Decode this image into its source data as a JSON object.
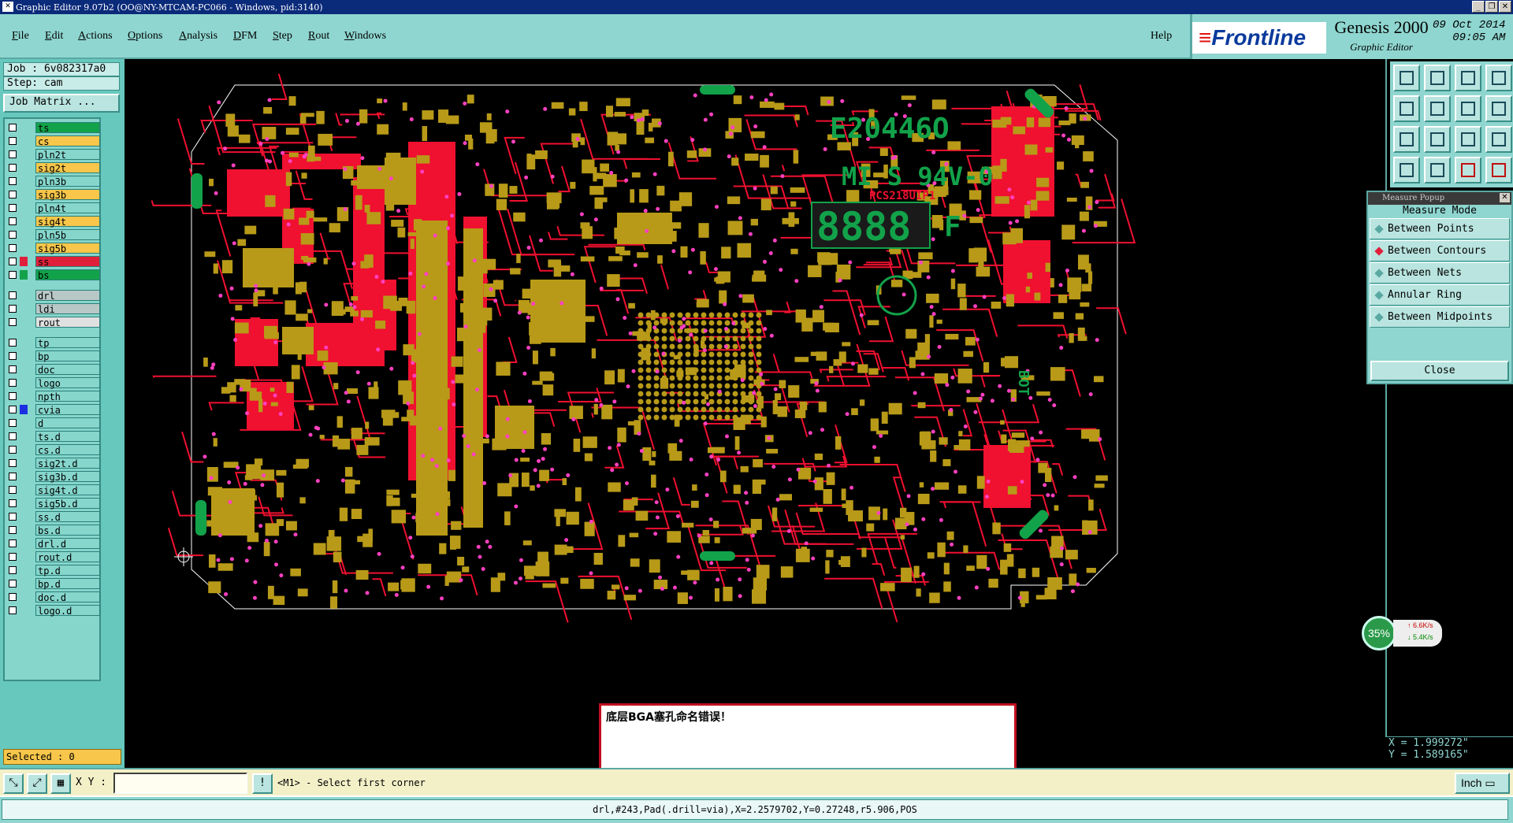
{
  "window": {
    "title": "Graphic Editor 9.07b2 (OO@NY-MTCAM-PC066 - Windows, pid:3140)",
    "controls": [
      "_",
      "❐",
      "✕"
    ]
  },
  "menu": [
    "File",
    "Edit",
    "Actions",
    "Options",
    "Analysis",
    "DFM",
    "Step",
    "Rout",
    "Windows"
  ],
  "help": "Help",
  "brand": {
    "logo": "Frontline",
    "product": "Genesis 2000",
    "subtitle": "Graphic Editor",
    "date": "09 Oct 2014",
    "time": "09:05 AM"
  },
  "left": {
    "job": "Job : 6v082317a0",
    "step": "Step: cam",
    "job_matrix": "Job Matrix ...",
    "selected": "Selected : 0",
    "layers": [
      {
        "name": "ts",
        "color": "#12a24a",
        "swatch": ""
      },
      {
        "name": "cs",
        "color": "#f7c64a",
        "swatch": ""
      },
      {
        "name": "pln2t",
        "color": "#86d6cc",
        "swatch": ""
      },
      {
        "name": "sig2t",
        "color": "#f7c64a",
        "swatch": ""
      },
      {
        "name": "pln3b",
        "color": "#86d6cc",
        "swatch": ""
      },
      {
        "name": "sig3b",
        "color": "#f7c64a",
        "swatch": ""
      },
      {
        "name": "pln4t",
        "color": "#86d6cc",
        "swatch": ""
      },
      {
        "name": "sig4t",
        "color": "#f7c64a",
        "swatch": ""
      },
      {
        "name": "pln5b",
        "color": "#86d6cc",
        "swatch": ""
      },
      {
        "name": "sig5b",
        "color": "#f7c64a",
        "swatch": ""
      },
      {
        "name": "ss",
        "color": "#e0203a",
        "swatch": "#e0203a"
      },
      {
        "name": "bs",
        "color": "#12a24a",
        "swatch": "#12a24a"
      },
      {
        "name": "drl",
        "color": "#b8c8c6",
        "swatch": ""
      },
      {
        "name": "ldi",
        "color": "#b8c8c6",
        "swatch": ""
      },
      {
        "name": "rout",
        "color": "#e0e0e0",
        "swatch": ""
      },
      {
        "name": "tp",
        "color": "#86d6cc",
        "swatch": ""
      },
      {
        "name": "bp",
        "color": "#86d6cc",
        "swatch": ""
      },
      {
        "name": "doc",
        "color": "#86d6cc",
        "swatch": ""
      },
      {
        "name": "logo",
        "color": "#86d6cc",
        "swatch": ""
      },
      {
        "name": "npth",
        "color": "#86d6cc",
        "swatch": ""
      },
      {
        "name": "cvia",
        "color": "#86d6cc",
        "swatch": "#1a30e0"
      },
      {
        "name": "d",
        "color": "#86d6cc",
        "swatch": ""
      },
      {
        "name": "ts.d",
        "color": "#86d6cc",
        "swatch": ""
      },
      {
        "name": "cs.d",
        "color": "#86d6cc",
        "swatch": ""
      },
      {
        "name": "sig2t.d",
        "color": "#86d6cc",
        "swatch": ""
      },
      {
        "name": "sig3b.d",
        "color": "#86d6cc",
        "swatch": ""
      },
      {
        "name": "sig4t.d",
        "color": "#86d6cc",
        "swatch": ""
      },
      {
        "name": "sig5b.d",
        "color": "#86d6cc",
        "swatch": ""
      },
      {
        "name": "ss.d",
        "color": "#86d6cc",
        "swatch": ""
      },
      {
        "name": "bs.d",
        "color": "#86d6cc",
        "swatch": ""
      },
      {
        "name": "drl.d",
        "color": "#86d6cc",
        "swatch": ""
      },
      {
        "name": "rout.d",
        "color": "#86d6cc",
        "swatch": ""
      },
      {
        "name": "tp.d",
        "color": "#86d6cc",
        "swatch": ""
      },
      {
        "name": "bp.d",
        "color": "#86d6cc",
        "swatch": ""
      },
      {
        "name": "doc.d",
        "color": "#86d6cc",
        "swatch": ""
      },
      {
        "name": "logo.d",
        "color": "#86d6cc",
        "swatch": ""
      }
    ]
  },
  "board": {
    "silk_texts": [
      "E20446O",
      "MI S 94V-0",
      "PCS218UIP1",
      "8888",
      "F",
      "BOT"
    ],
    "copper_color": "#b89a18",
    "solder_color": "#f01030",
    "via_color": "#ff40c0",
    "silk_color": "#12a24a"
  },
  "measure": {
    "title": "Measure Popup",
    "mode_label": "Measure Mode",
    "options": [
      {
        "label": "Between Points",
        "on": false
      },
      {
        "label": "Between Contours",
        "on": true
      },
      {
        "label": "Between Nets",
        "on": false
      },
      {
        "label": "Annular Ring",
        "on": false
      },
      {
        "label": "Between Midpoints",
        "on": false
      }
    ],
    "close": "Close"
  },
  "netmon": {
    "percent": "35%",
    "up": "6.6K/s",
    "down": "5.4K/s"
  },
  "coords": {
    "x": "X = 1.999272\"",
    "y": "Y = 1.589165\""
  },
  "message": "底层BGA塞孔命名错误！",
  "cmd": {
    "xy_label": "X Y :",
    "xy_value": "",
    "prompt": "<M1> - Select first corner",
    "units": "Inch"
  },
  "status": "drl,#243,Pad(.drill=via),X=2.2579702,Y=0.27248,r5.906,POS"
}
